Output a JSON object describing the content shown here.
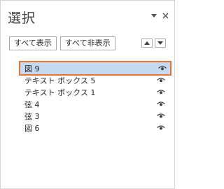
{
  "pane": {
    "title": "選択",
    "show_all_label": "すべて表示",
    "hide_all_label": "すべて非表示",
    "controls": [
      "dropdown-arrow-icon",
      "close-icon"
    ]
  },
  "shapes": [
    {
      "name": "図 9",
      "selected": true,
      "visible": true
    },
    {
      "name": "テキスト ボックス 5",
      "selected": false,
      "visible": true
    },
    {
      "name": "テキスト ボックス 1",
      "selected": false,
      "visible": true
    },
    {
      "name": "弦 4",
      "selected": false,
      "visible": true
    },
    {
      "name": "弦 3",
      "selected": false,
      "visible": true
    },
    {
      "name": "図 6",
      "selected": false,
      "visible": true
    }
  ],
  "colors": {
    "selection_bg": "#c5d9f1",
    "selection_border": "#e57534"
  }
}
